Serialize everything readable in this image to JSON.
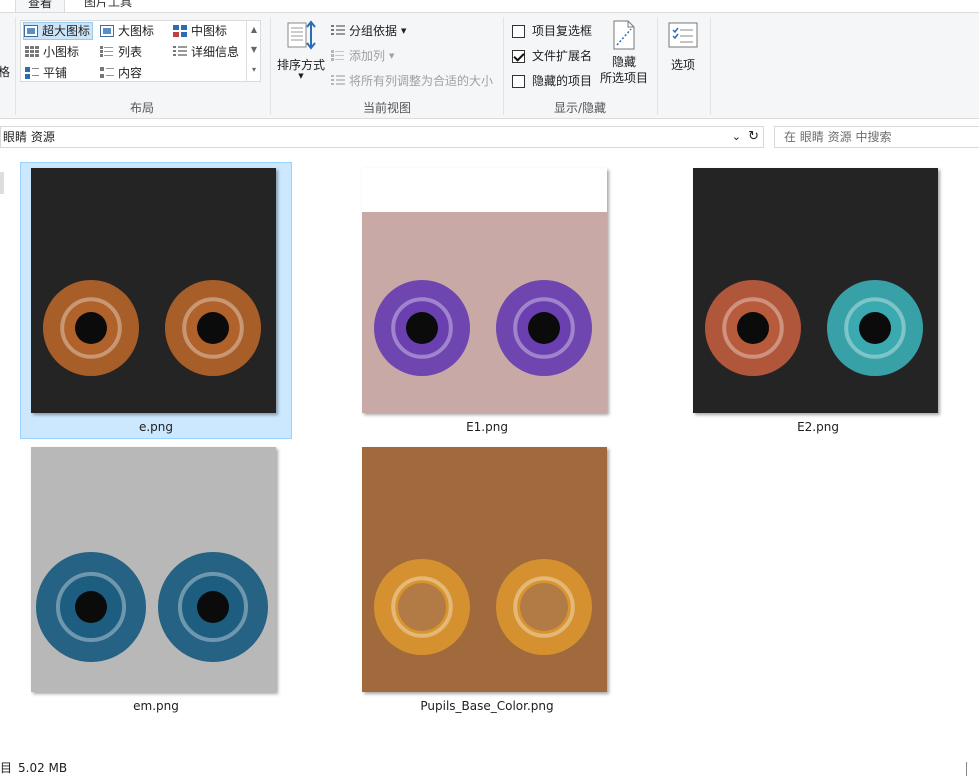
{
  "ribbon_tabs": {
    "active": "查看",
    "other": "图片工具"
  },
  "layout_group": {
    "items": [
      "超大图标",
      "大图标",
      "中图标",
      "小图标",
      "列表",
      "详细信息",
      "平铺",
      "内容"
    ],
    "label": "布局",
    "cut_left": "格"
  },
  "current_view": {
    "sort_label": "排序方式",
    "group_by": "分组依据",
    "add_columns": "添加列",
    "size_all_columns": "将所有列调整为合适的大小",
    "label": "当前视图"
  },
  "show_hide": {
    "item_checkboxes": "项目复选框",
    "file_extensions": "文件扩展名",
    "hidden_items": "隐藏的项目",
    "hide_selected_line1": "隐藏",
    "hide_selected_line2": "所选项目",
    "label": "显示/隐藏",
    "checked": {
      "item_checkboxes": false,
      "file_extensions": true,
      "hidden_items": false
    }
  },
  "options_label": "选项",
  "address": {
    "path": "眼睛 资源",
    "cut_prefix": "|"
  },
  "search": {
    "placeholder": "在 眼睛 资源 中搜索"
  },
  "files": [
    {
      "name": "e.png",
      "selected": true,
      "iris": "#b0622a",
      "iris2": "#b0622a",
      "bg": "#242424"
    },
    {
      "name": "E1.png",
      "selected": false,
      "iris": "#6a3fb0",
      "iris2": "#6a3fb0",
      "bg": "#c8a9a5"
    },
    {
      "name": "E2.png",
      "selected": false,
      "iris": "#b85a3c",
      "iris2": "#3aa9b0",
      "bg": "#242424"
    },
    {
      "name": "em.png",
      "selected": false,
      "iris": "#1c5d80",
      "iris2": "#1c5d80",
      "bg": "#b8b8b8"
    },
    {
      "name": "Pupils_Base_Color.png",
      "selected": false,
      "iris": "#d8942e",
      "iris2": "#d8942e",
      "bg": "#a06a3c"
    }
  ],
  "status": {
    "size": "5.02 MB",
    "cut_prefix": "目"
  }
}
